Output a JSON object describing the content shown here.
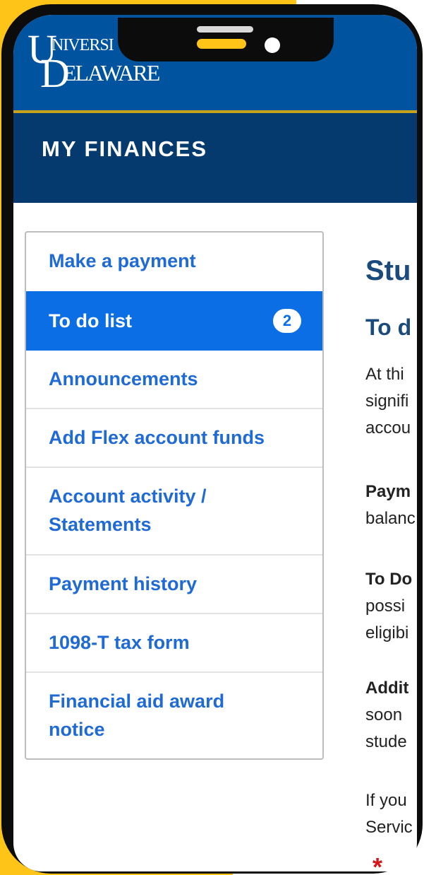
{
  "header": {
    "logo_line1": "NIVERSI",
    "logo_line2": "ELAWARE",
    "logo_initial_u": "U",
    "logo_initial_d": "D",
    "section_title": "MY FINANCES"
  },
  "menu": {
    "items": [
      {
        "label": "Make a payment"
      },
      {
        "label": "To do list",
        "badge": "2",
        "active": true
      },
      {
        "label": "Announcements"
      },
      {
        "label": "Add Flex account funds"
      },
      {
        "label_line1": "Account activity /",
        "label_line2": "Statements"
      },
      {
        "label": "Payment history"
      },
      {
        "label": "1098-T tax form"
      },
      {
        "label_line1": "Financial aid award",
        "label_line2": "notice"
      }
    ]
  },
  "content": {
    "heading": "Stu",
    "subheading": "To d",
    "para1": [
      "At thi",
      "signifi",
      "accou"
    ],
    "para2_bold": "Paym",
    "para2": "balanc",
    "para3_bold": "To Do",
    "para3": [
      "possi",
      "eligibi"
    ],
    "para4_bold": "Addit",
    "para4": [
      "soon",
      "stude"
    ],
    "para5": [
      "If you",
      "Servic"
    ],
    "required_mark": "*"
  },
  "colors": {
    "brand_blue": "#00539f",
    "dark_blue": "#053a6e",
    "gold": "#c9a21c",
    "menu_link": "#1f6ad4",
    "active": "#0b6ee5",
    "phone_frame": "#0c0c0c",
    "background_yellow": "#fec418"
  }
}
